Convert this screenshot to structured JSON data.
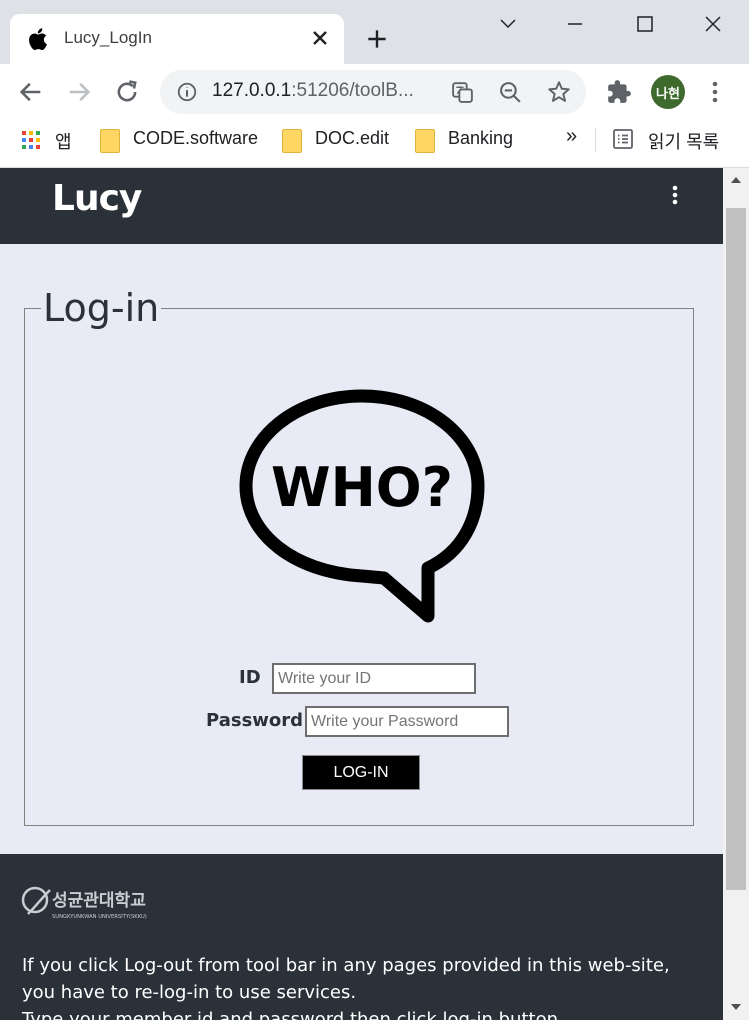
{
  "browser": {
    "tab_title": "Lucy_LogIn",
    "url_host": "127.0.0.1",
    "url_rest": ":51206/toolB...",
    "profile_initials": "나현",
    "bookmarks": {
      "apps_label": "앱",
      "items": [
        "CODE.software",
        "DOC.edit",
        "Banking"
      ],
      "more": "»",
      "reading_list": "읽기 목록"
    }
  },
  "page": {
    "brand": "Lucy",
    "login": {
      "legend": "Log-in",
      "id_label": "ID",
      "id_placeholder": "Write your ID",
      "password_label": "Password",
      "password_placeholder": "Write your Password",
      "submit_label": "LOG-IN",
      "image_text": "WHO?"
    },
    "footer": {
      "university_name": "성균관대학교",
      "university_subtitle": "SUNGKYUNKWAN UNIVERSITY(SKKU)",
      "lines": [
        "If you click Log-out from tool bar in any pages provided in this web-site,",
        "you have to re-log-in to use services.",
        "Type your member id and password then click log-in button."
      ]
    }
  },
  "colors": {
    "header_bg": "#2a3139",
    "page_bg": "#e8eaf5",
    "button_bg": "#000000",
    "avatar_bg": "#3f6a2d"
  }
}
